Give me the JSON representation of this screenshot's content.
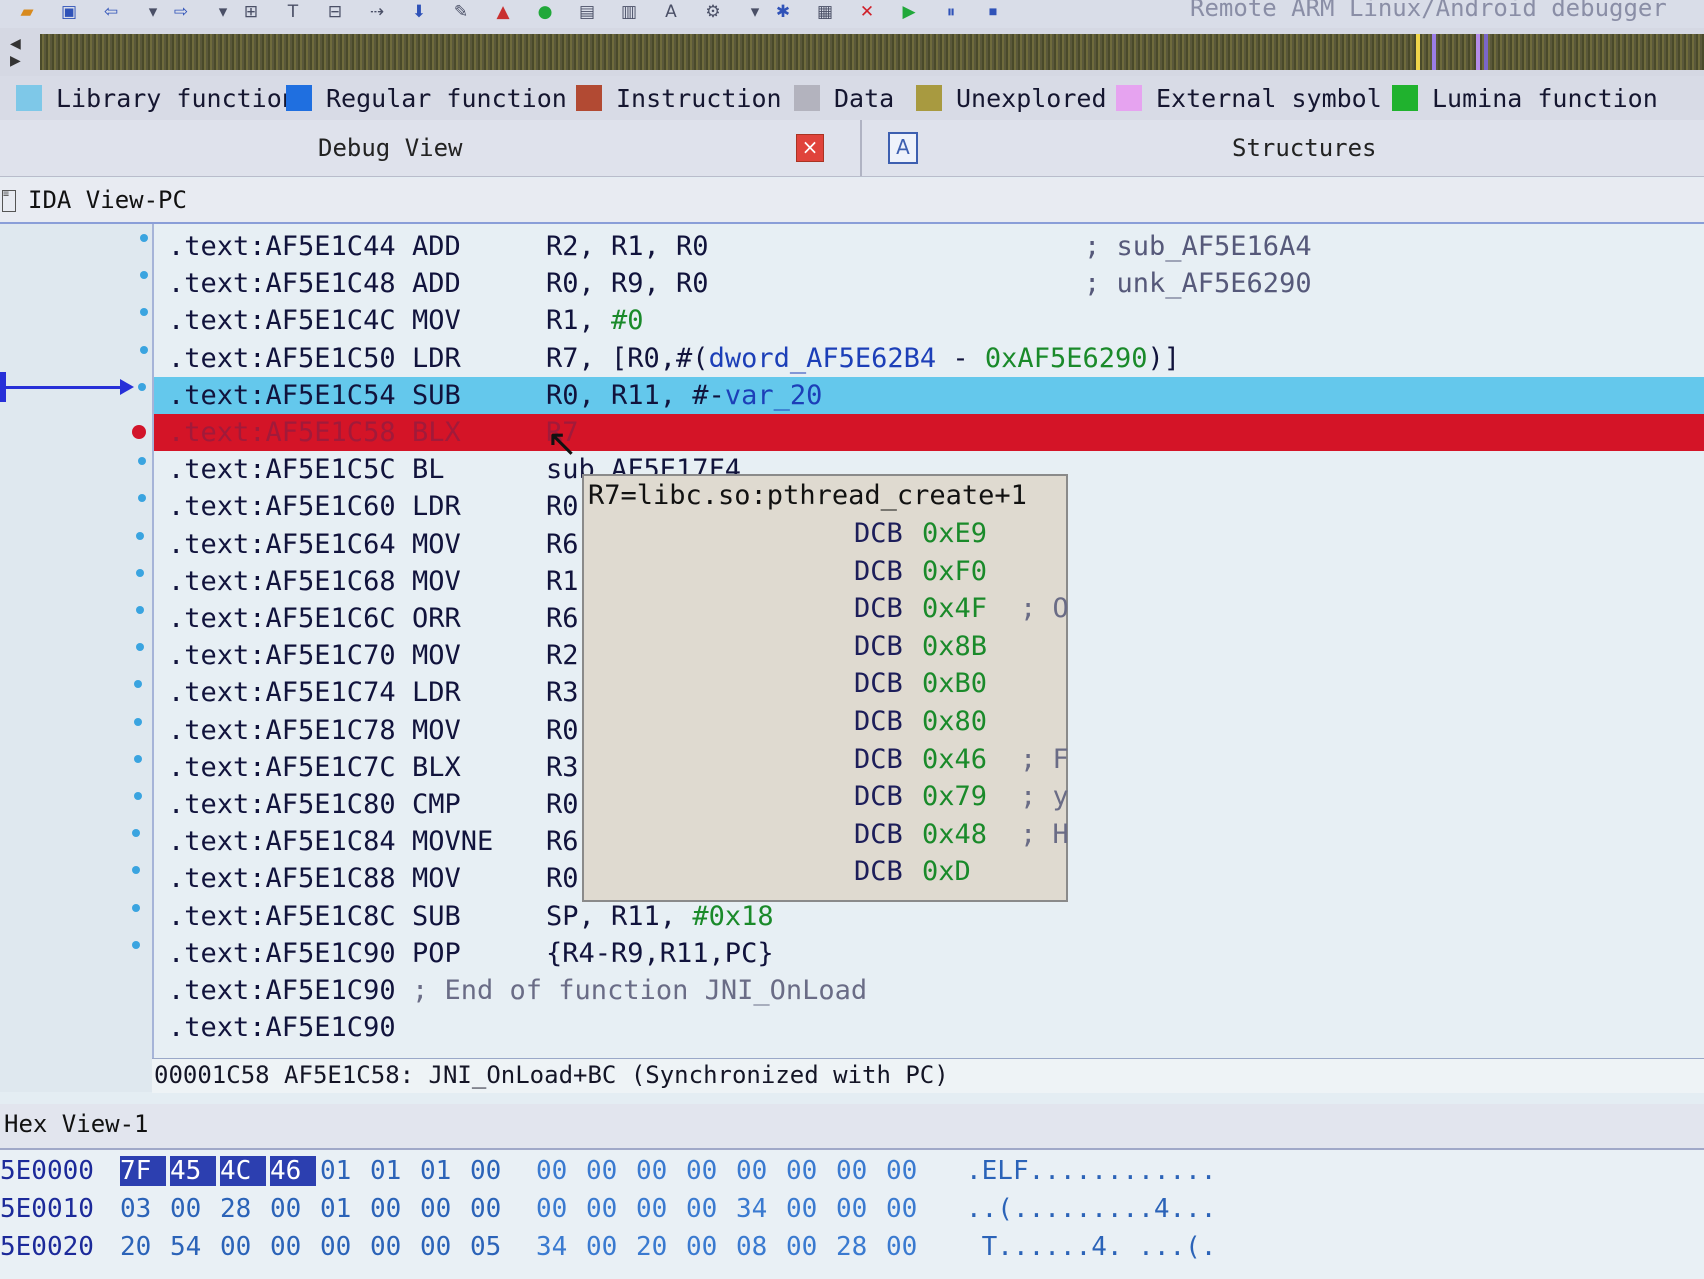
{
  "toolbar": {
    "title": "Remote ARM Linux/Android debugger",
    "icons": [
      "open-icon",
      "save-icon",
      "back-icon",
      "dropdown-icon",
      "forward-icon",
      "dropdown-icon",
      "jump-icon",
      "text-icon",
      "hex-icon",
      "nav-icon",
      "step-down-icon",
      "script-icon",
      "warning-icon",
      "green-circle-icon",
      "code-icon",
      "data-icon",
      "string-icon",
      "structure-icon",
      "dropdown-icon",
      "gear-icon",
      "graph-icon",
      "stop-icon",
      "play-icon",
      "pause-icon",
      "detach-icon"
    ]
  },
  "legend": [
    {
      "label": "Library function",
      "color": "#7ec8e8"
    },
    {
      "label": "Regular function",
      "color": "#1f6fe0"
    },
    {
      "label": "Instruction",
      "color": "#b24a33"
    },
    {
      "label": "Data",
      "color": "#b3b3be"
    },
    {
      "label": "Unexplored",
      "color": "#a89a40"
    },
    {
      "label": "External symbol",
      "color": "#e6a3f0"
    },
    {
      "label": "Lumina function",
      "color": "#20b22e"
    }
  ],
  "tabs": {
    "debug_view": "Debug View",
    "close_glyph": "×",
    "structures_icon_glyph": "A",
    "structures": "Structures"
  },
  "ida_view": {
    "title": "IDA View-PC",
    "rows": [
      {
        "addr": ".text:AF5E1C44",
        "mn": "ADD",
        "ops": "R2, R1, R0",
        "comment": "; sub_AF5E16A4"
      },
      {
        "addr": ".text:AF5E1C48",
        "mn": "ADD",
        "ops": "R0, R9, R0",
        "comment": "; unk_AF5E6290"
      },
      {
        "addr": ".text:AF5E1C4C",
        "mn": "MOV",
        "ops": "R1, #0",
        "comment": ""
      },
      {
        "addr": ".text:AF5E1C50",
        "mn": "LDR",
        "ops": "R7, [R0,#(dword_AF5E62B4 - 0xAF5E6290)]",
        "comment": ""
      },
      {
        "addr": ".text:AF5E1C54",
        "mn": "SUB",
        "ops": "R0, R11, #-var_20",
        "comment": ""
      },
      {
        "addr": ".text:AF5E1C58",
        "mn": "BLX",
        "ops": "R7",
        "comment": ""
      },
      {
        "addr": ".text:AF5E1C5C",
        "mn": "BL",
        "ops": "sub_AF5E17F4",
        "comment": ""
      },
      {
        "addr": ".text:AF5E1C60",
        "mn": "LDR",
        "ops": "R0,",
        "comment": ""
      },
      {
        "addr": ".text:AF5E1C64",
        "mn": "MOV",
        "ops": "R6,",
        "comment": ""
      },
      {
        "addr": ".text:AF5E1C68",
        "mn": "MOV",
        "ops": "R1,",
        "comment": ""
      },
      {
        "addr": ".text:AF5E1C6C",
        "mn": "ORR",
        "ops": "R6,",
        "comment": ""
      },
      {
        "addr": ".text:AF5E1C70",
        "mn": "MOV",
        "ops": "R2,",
        "comment": ""
      },
      {
        "addr": ".text:AF5E1C74",
        "mn": "LDR",
        "ops": "R3,",
        "comment": ""
      },
      {
        "addr": ".text:AF5E1C78",
        "mn": "MOV",
        "ops": "R0,",
        "comment": ""
      },
      {
        "addr": ".text:AF5E1C7C",
        "mn": "BLX",
        "ops": "R3",
        "comment": ""
      },
      {
        "addr": ".text:AF5E1C80",
        "mn": "CMP",
        "ops": "R0,",
        "comment": ""
      },
      {
        "addr": ".text:AF5E1C84",
        "mn": "MOVNE",
        "ops": "R6,",
        "comment": ""
      },
      {
        "addr": ".text:AF5E1C88",
        "mn": "MOV",
        "ops": "R0,",
        "comment": ""
      },
      {
        "addr": ".text:AF5E1C8C",
        "mn": "SUB",
        "ops": "SP, R11, #0x18",
        "comment": ""
      },
      {
        "addr": ".text:AF5E1C90",
        "mn": "POP",
        "ops": "{R4-R9,R11,PC}",
        "comment": ""
      },
      {
        "addr": ".text:AF5E1C90",
        "mn": "",
        "ops": "",
        "comment": "; End of function JNI_OnLoad"
      },
      {
        "addr": ".text:AF5E1C90",
        "mn": "",
        "ops": "",
        "comment": ""
      }
    ],
    "status": "00001C58 AF5E1C58: JNI_OnLoad+BC (Synchronized with PC)"
  },
  "tooltip": {
    "title": "R7=libc.so:pthread_create+1",
    "rows": [
      {
        "dcb": "DCB",
        "val": "0xE9",
        "cm": ""
      },
      {
        "dcb": "DCB",
        "val": "0xF0",
        "cm": ""
      },
      {
        "dcb": "DCB",
        "val": "0x4F",
        "cm": "; O"
      },
      {
        "dcb": "DCB",
        "val": "0x8B",
        "cm": ""
      },
      {
        "dcb": "DCB",
        "val": "0xB0",
        "cm": ""
      },
      {
        "dcb": "DCB",
        "val": "0x80",
        "cm": ""
      },
      {
        "dcb": "DCB",
        "val": "0x46",
        "cm": "; F"
      },
      {
        "dcb": "DCB",
        "val": "0x79",
        "cm": "; y"
      },
      {
        "dcb": "DCB",
        "val": "0x48",
        "cm": "; H"
      },
      {
        "dcb": "DCB",
        "val": "0xD",
        "cm": ""
      }
    ]
  },
  "hex_view": {
    "title": "Hex View-1",
    "rows": [
      {
        "addr": "5E0000",
        "bytes": [
          "7F",
          "45",
          "4C",
          "46",
          "01",
          "01",
          "01",
          "00",
          "00",
          "00",
          "00",
          "00",
          "00",
          "00",
          "00",
          "00"
        ],
        "ascii": ".ELF............"
      },
      {
        "addr": "5E0010",
        "bytes": [
          "03",
          "00",
          "28",
          "00",
          "01",
          "00",
          "00",
          "00",
          "00",
          "00",
          "00",
          "00",
          "34",
          "00",
          "00",
          "00"
        ],
        "ascii": "..(.........4..."
      },
      {
        "addr": "5E0020",
        "bytes": [
          "20",
          "54",
          "00",
          "00",
          "00",
          "00",
          "00",
          "05",
          "34",
          "00",
          "20",
          "00",
          "08",
          "00",
          "28",
          "00"
        ],
        "ascii": " T......4. ...(."
      }
    ]
  }
}
